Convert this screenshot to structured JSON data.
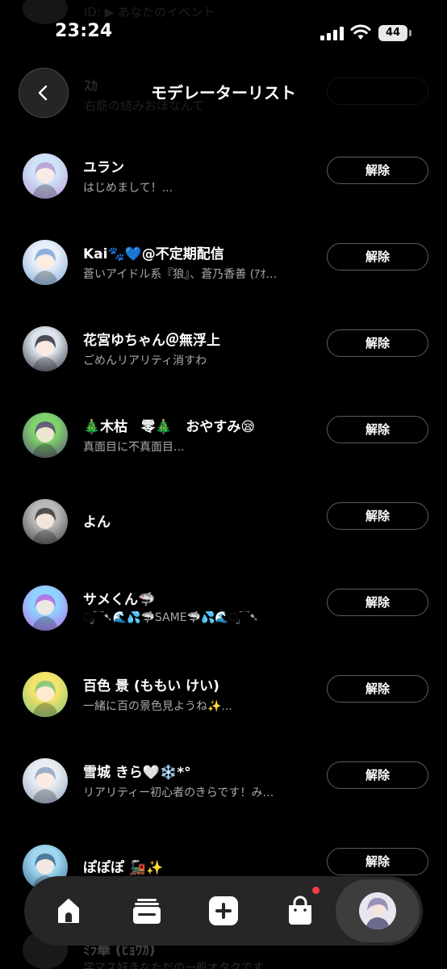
{
  "status_bar": {
    "time": "23:24",
    "battery": "44"
  },
  "header": {
    "title": "モデレーターリスト"
  },
  "ghost_rows": {
    "sub0": "ID: ▶︎ あなたのイベント",
    "name": "ｽｶ",
    "sub": "右筋の続みおほなんて"
  },
  "remove_label": "解除",
  "moderators": [
    {
      "name": "ユラン",
      "sub": "はじめまして！...",
      "color_a": "#cfe3f7",
      "color_b": "#b79ad8"
    },
    {
      "name": "Kai🐾💙@不定期配信",
      "sub": "蒼いアイドル系『狼』、蒼乃香善 (ｱｵ…",
      "color_a": "#e6eef8",
      "color_b": "#7aa4d8"
    },
    {
      "name": "花宮ゆちゃん＠無浮上",
      "sub": "ごめんリアリティ消すわ",
      "color_a": "#dde3ea",
      "color_b": "#2f3440"
    },
    {
      "name": "🎄木枯　零🎄　おやすみ😪",
      "sub": "真面目に不真面目...",
      "color_a": "#7fd36b",
      "color_b": "#5a4a7a"
    },
    {
      "name": "よん",
      "sub": "",
      "color_a": "#b9b9b9",
      "color_b": "#3b3b3b"
    },
    {
      "name": "サメくん🦈",
      "sub": "ೃ⁀➷🌊💦🦈SAME🦈💦🌊ೃ⁀➷",
      "color_a": "#8fd3ff",
      "color_b": "#b06ae6"
    },
    {
      "name": "百色 景 (ももい けい)",
      "sub": "一緒に百の景色見ようね✨...",
      "color_a": "#f4e36b",
      "color_b": "#7cc37a"
    },
    {
      "name": "雪城 きら🤍❄️*°",
      "sub": "リアリティー初心者のきらです！み…",
      "color_a": "#e8ecf2",
      "color_b": "#8fa3c0"
    },
    {
      "name": "ぽぽぽ 🚂✨",
      "sub": "",
      "color_a": "#9fd7f0",
      "color_b": "#3d6a8f"
    }
  ],
  "faded_row": {
    "name": "ﾐﾗ華 (ﾋｮｳｶ)",
    "sub": "学マス好きなただの一般オタクです"
  },
  "nav": {
    "items": [
      "home",
      "stack",
      "create",
      "shop",
      "profile"
    ]
  }
}
